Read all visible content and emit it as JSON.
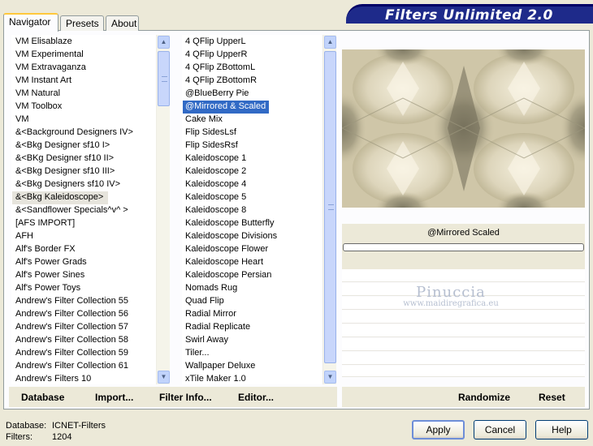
{
  "title": "Filters Unlimited 2.0",
  "tabs": {
    "navigator": "Navigator",
    "presets": "Presets",
    "about": "About"
  },
  "categories": [
    "VM Elisablaze",
    "VM Experimental",
    "VM Extravaganza",
    "VM Instant Art",
    "VM Natural",
    "VM Toolbox",
    "VM",
    "&<Background Designers IV>",
    "&<Bkg Designer sf10 I>",
    "&<BKg Designer sf10 II>",
    "&<Bkg Designer sf10 III>",
    "&<Bkg Designers sf10 IV>",
    "&<Bkg Kaleidoscope>",
    "&<Sandflower Specials^v^ >",
    "[AFS IMPORT]",
    "AFH",
    "Alf's Border FX",
    "Alf's Power Grads",
    "Alf's Power Sines",
    "Alf's Power Toys",
    "Andrew's Filter Collection 55",
    "Andrew's Filter Collection 56",
    "Andrew's Filter Collection 57",
    "Andrew's Filter Collection 58",
    "Andrew's Filter Collection 59",
    "Andrew's Filter Collection 61",
    "Andrew's Filters 10"
  ],
  "selected_category_index": 12,
  "filters": [
    "4 QFlip UpperL",
    "4 QFlip UpperR",
    "4 QFlip ZBottomL",
    "4 QFlip ZBottomR",
    "@BlueBerry Pie",
    "@Mirrored & Scaled",
    "Cake Mix",
    "Flip SidesLsf",
    "Flip SidesRsf",
    "Kaleidoscope 1",
    "Kaleidoscope 2",
    "Kaleidoscope 4",
    "Kaleidoscope 5",
    "Kaleidoscope 8",
    "Kaleidoscope Butterfly",
    "Kaleidoscope Divisions",
    "Kaleidoscope Flower",
    "Kaleidoscope Heart",
    "Kaleidoscope Persian",
    "Nomads Rug",
    "Quad Flip",
    "Radial Mirror",
    "Radial Replicate",
    "Swirl Away",
    "Tiler...",
    "Wallpaper Deluxe",
    "xTile Maker 1.0"
  ],
  "selected_filter_index": 5,
  "preview": {
    "filter_name": "@Mirrored  Scaled",
    "colors": {
      "light": "#efe9d4",
      "mid": "#c9c0a1",
      "dark": "#8f8a72"
    }
  },
  "watermark": {
    "name": "Pinuccia",
    "url": "www.maidiregrafica.eu"
  },
  "toolbar": {
    "database": "Database",
    "import": "Import...",
    "filter_info": "Filter Info...",
    "editor": "Editor...",
    "randomize": "Randomize",
    "reset": "Reset"
  },
  "footer": {
    "database_label": "Database:",
    "database_value": "ICNET-Filters",
    "filters_label": "Filters:",
    "filters_value": "1204"
  },
  "buttons": {
    "apply": "Apply",
    "cancel": "Cancel",
    "help": "Help"
  }
}
